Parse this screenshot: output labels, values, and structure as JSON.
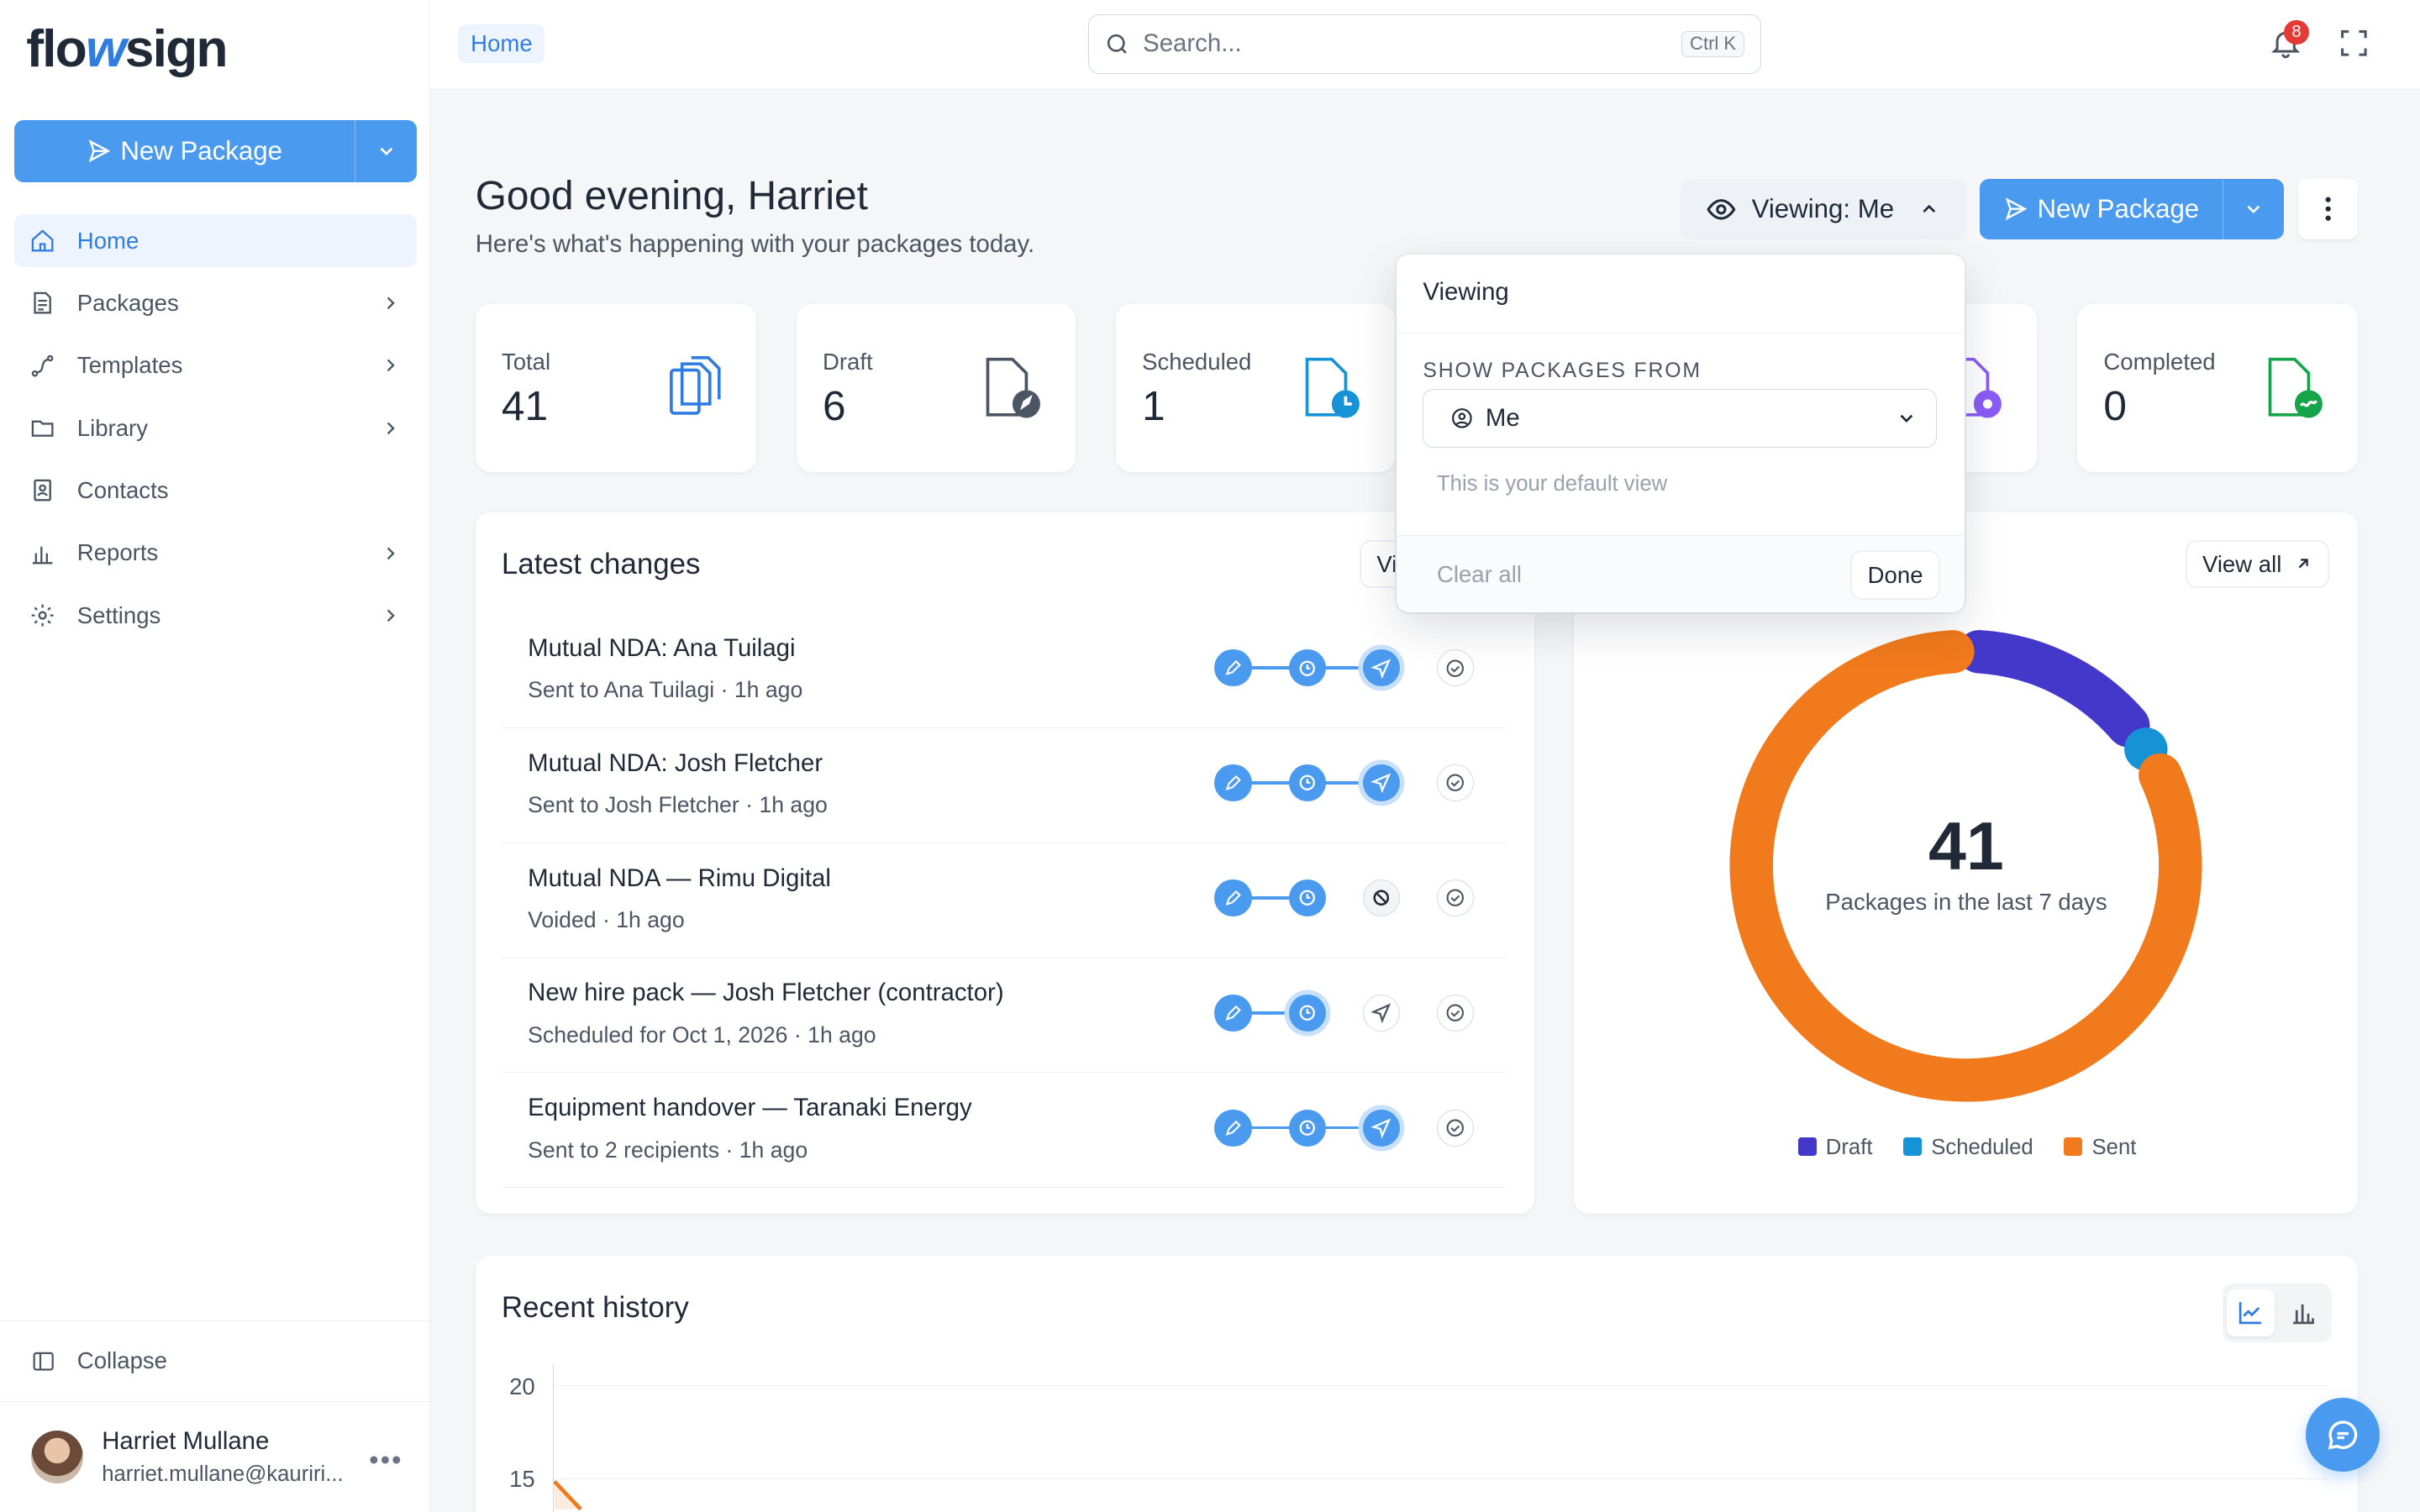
{
  "brand": {
    "logo_pre": "flo",
    "logo_mid": "w",
    "logo_post": "sign",
    "accent": "#4a9bf0"
  },
  "sidebar": {
    "new_package": "New Package",
    "items": [
      {
        "label": "Home",
        "icon": "home-icon",
        "active": true,
        "chevron": false
      },
      {
        "label": "Packages",
        "icon": "document-icon",
        "chevron": true
      },
      {
        "label": "Templates",
        "icon": "route-icon",
        "chevron": true
      },
      {
        "label": "Library",
        "icon": "folder-icon",
        "chevron": true
      },
      {
        "label": "Contacts",
        "icon": "contact-book-icon",
        "chevron": false
      },
      {
        "label": "Reports",
        "icon": "bar-chart-icon",
        "chevron": true
      },
      {
        "label": "Settings",
        "icon": "gear-icon",
        "chevron": true
      }
    ],
    "collapse": "Collapse",
    "user": {
      "name": "Harriet Mullane",
      "email": "harriet.mullane@kauriri..."
    }
  },
  "topbar": {
    "breadcrumb": "Home",
    "search_placeholder": "Search...",
    "search_shortcut": "Ctrl K",
    "notifications": "8"
  },
  "header": {
    "greeting": "Good evening, Harriet",
    "subtitle": "Here's what's happening with your packages today.",
    "viewing": "Viewing: Me",
    "new_package": "New Package"
  },
  "stats": [
    {
      "label": "Total",
      "value": "41",
      "icon": "copies-icon"
    },
    {
      "label": "Draft",
      "value": "6",
      "icon": "draft-document-icon"
    },
    {
      "label": "Scheduled",
      "value": "1",
      "icon": "scheduled-document-icon"
    },
    {
      "label": "Completed",
      "value": "0",
      "icon": "completed-document-icon"
    }
  ],
  "latest": {
    "title": "Latest changes",
    "view_all": "View all",
    "rows": [
      {
        "title": "Mutual NDA: Ana Tuilagi",
        "sub": "Sent to Ana Tuilagi · 1h ago",
        "state": "sent"
      },
      {
        "title": "Mutual NDA: Josh Fletcher",
        "sub": "Sent to Josh Fletcher · 1h ago",
        "state": "sent"
      },
      {
        "title": "Mutual NDA — Rimu Digital",
        "sub": "Voided · 1h ago",
        "state": "voided"
      },
      {
        "title": "New hire pack — Josh Fletcher (contractor)",
        "sub": "Scheduled for Oct 1, 2026 · 1h ago",
        "state": "scheduled"
      },
      {
        "title": "Equipment handover — Taranaki Energy",
        "sub": "Sent to 2 recipients · 1h ago",
        "state": "sent"
      }
    ]
  },
  "donut": {
    "view_all": "View all",
    "total": "41",
    "caption": "Packages in the last 7 days"
  },
  "chart_data": {
    "type": "pie",
    "title": "",
    "categories": [
      "Draft",
      "Scheduled",
      "Sent"
    ],
    "values": [
      6,
      1,
      34
    ],
    "colors": [
      "#4338ca",
      "#1593d6",
      "#f07a1c"
    ],
    "legend": "bottom"
  },
  "popover": {
    "title": "Viewing",
    "section": "SHOW PACKAGES FROM",
    "selected": "Me",
    "hint": "This is your default view",
    "clear": "Clear all",
    "done": "Done"
  },
  "history": {
    "title": "Recent history",
    "y_ticks": [
      "20",
      "15"
    ]
  }
}
